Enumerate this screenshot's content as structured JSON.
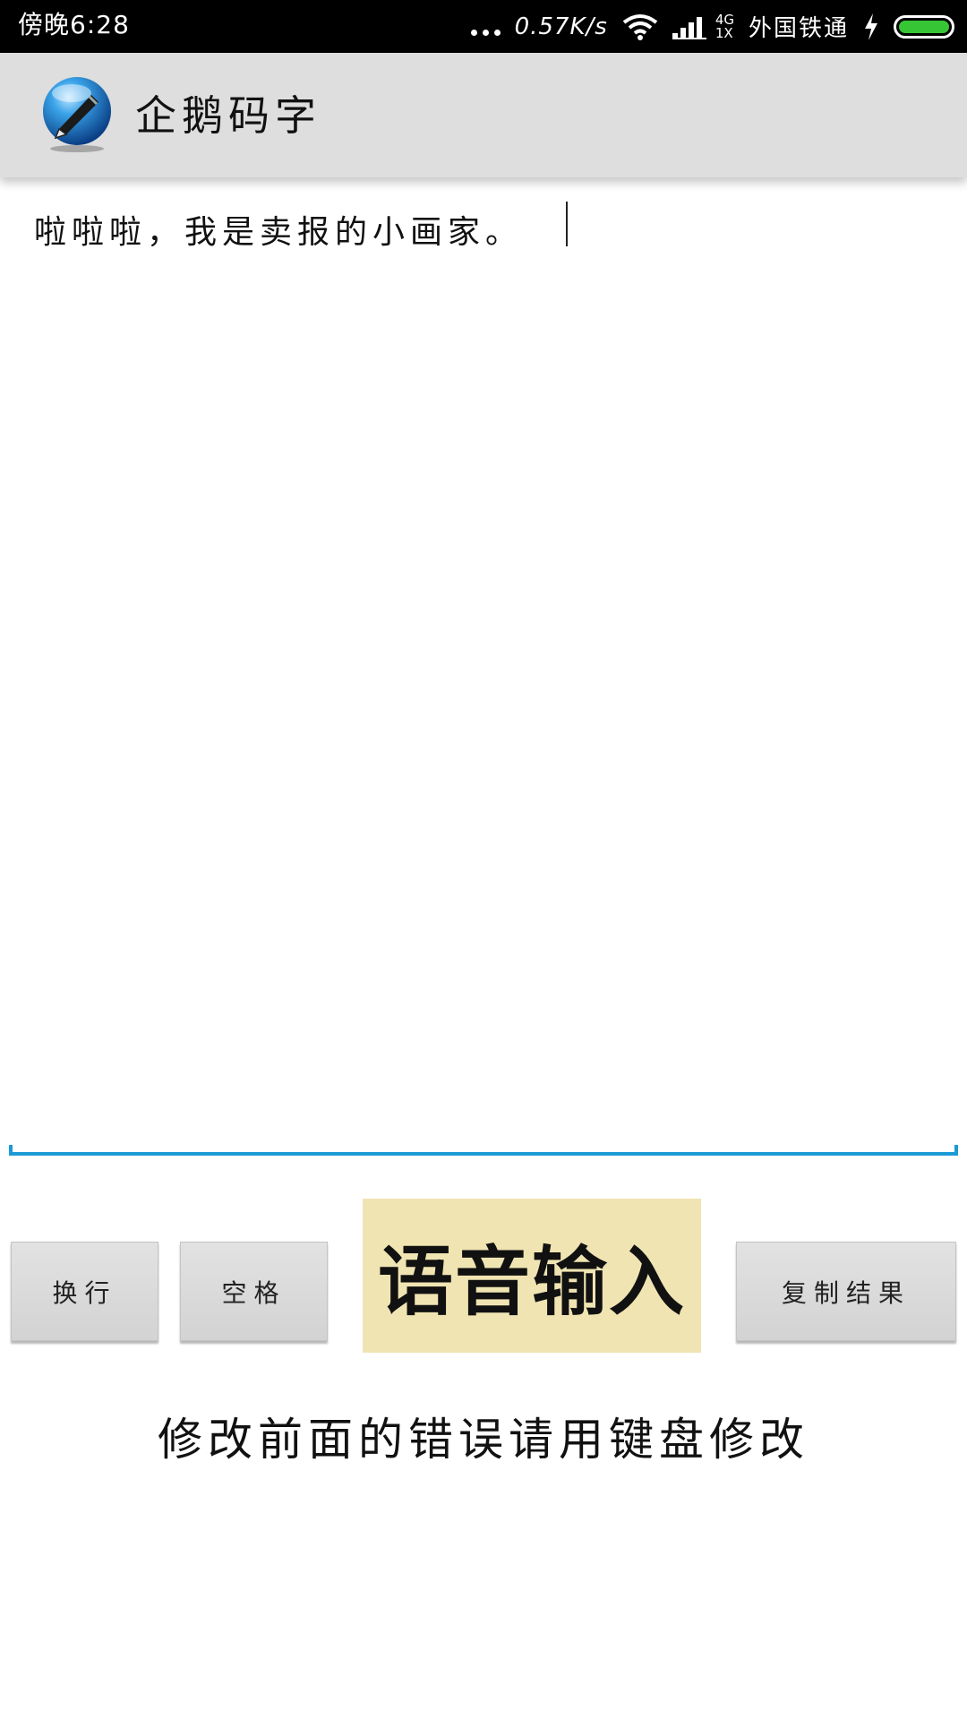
{
  "status_bar": {
    "time": "傍晚6:28",
    "speed": "0.57K/s",
    "network_top": "4G",
    "network_bottom": "1X",
    "carrier": "外国铁通",
    "battery_level": 1.0,
    "icons": [
      "more-dots-icon",
      "wifi-icon",
      "signal-icon",
      "charging-icon",
      "battery-icon"
    ]
  },
  "app_bar": {
    "title": "企鹅码字",
    "logo_icon": "pen-globe-icon"
  },
  "editor": {
    "text": "啦啦啦，我是卖报的小画家。"
  },
  "buttons": {
    "newline": "换行",
    "space": "空格",
    "voice": "语音输入",
    "copy": "复制结果"
  },
  "hint": "修改前面的错误请用键盘修改",
  "colors": {
    "status_bar": "#000000",
    "app_bar": "#dedede",
    "accent_line": "#1a9ad6",
    "voice_button": "#f0e4b2",
    "button": "#d9d9d9",
    "battery": "#36c635"
  }
}
